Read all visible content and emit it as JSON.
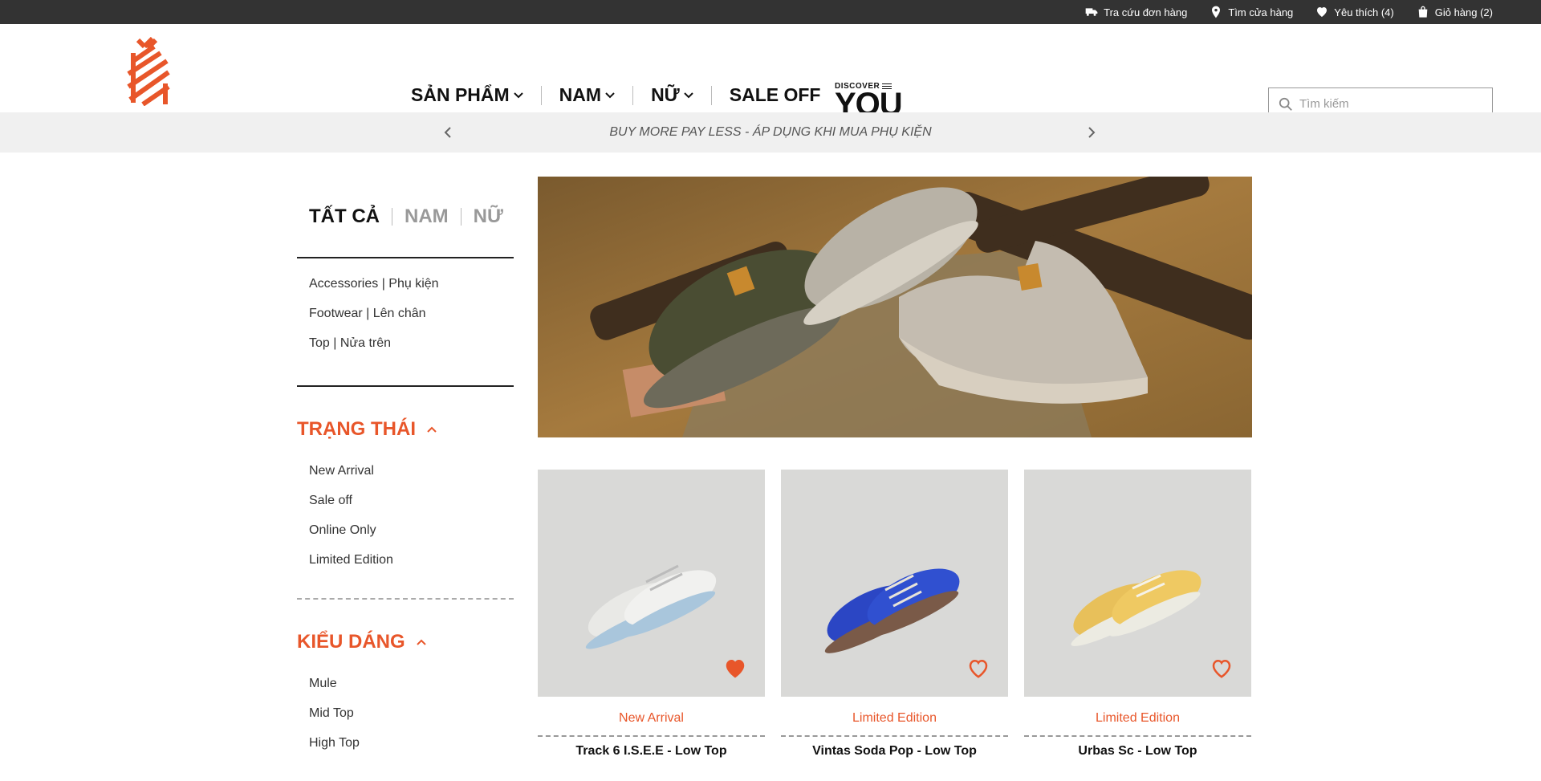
{
  "topbar": {
    "items": [
      {
        "label": "Tra cứu đơn hàng",
        "icon": "truck-icon"
      },
      {
        "label": "Tìm cửa hàng",
        "icon": "map-pin-icon"
      },
      {
        "label": "Yêu thích (4)",
        "icon": "heart-icon"
      },
      {
        "label": "Giỏ hàng (2)",
        "icon": "shopping-bag-icon"
      }
    ]
  },
  "header": {
    "nav": [
      {
        "label": "SẢN PHẨM",
        "has_dropdown": true
      },
      {
        "label": "NAM",
        "has_dropdown": true
      },
      {
        "label": "NỮ",
        "has_dropdown": true
      },
      {
        "label": "SALE OFF",
        "has_dropdown": false
      }
    ],
    "discover": {
      "top": "DISCOVER",
      "main": "YOU"
    },
    "search": {
      "placeholder": "Tìm kiếm"
    }
  },
  "promo": {
    "text": "BUY MORE PAY LESS - ÁP DỤNG KHI MUA PHỤ KIỆN"
  },
  "sidebar": {
    "gender_tabs": [
      "TẤT CẢ",
      "NAM",
      "NỮ"
    ],
    "active_tab": "TẤT CẢ",
    "categories": [
      "Accessories | Phụ kiện",
      "Footwear | Lên chân",
      "Top | Nửa trên"
    ],
    "status_filter": {
      "title": "TRẠNG THÁI",
      "options": [
        "New Arrival",
        "Sale off",
        "Online Only",
        "Limited Edition"
      ]
    },
    "style_filter": {
      "title": "KIỂU DÁNG",
      "options": [
        "Mule",
        "Mid Top",
        "High Top"
      ]
    }
  },
  "products": [
    {
      "badge": "New Arrival",
      "name": "Track 6 I.S.E.E - Low Top",
      "favorited": true,
      "color": "#e9e9e6"
    },
    {
      "badge": "Limited Edition",
      "name": "Vintas Soda Pop - Low Top",
      "favorited": false,
      "color": "#2b46c4"
    },
    {
      "badge": "Limited Edition",
      "name": "Urbas Sc - Low Top",
      "favorited": false,
      "color": "#e8c05a"
    }
  ],
  "colors": {
    "accent": "#e8562a",
    "topbar": "#333333",
    "promo_bg": "#f0f0f0"
  }
}
